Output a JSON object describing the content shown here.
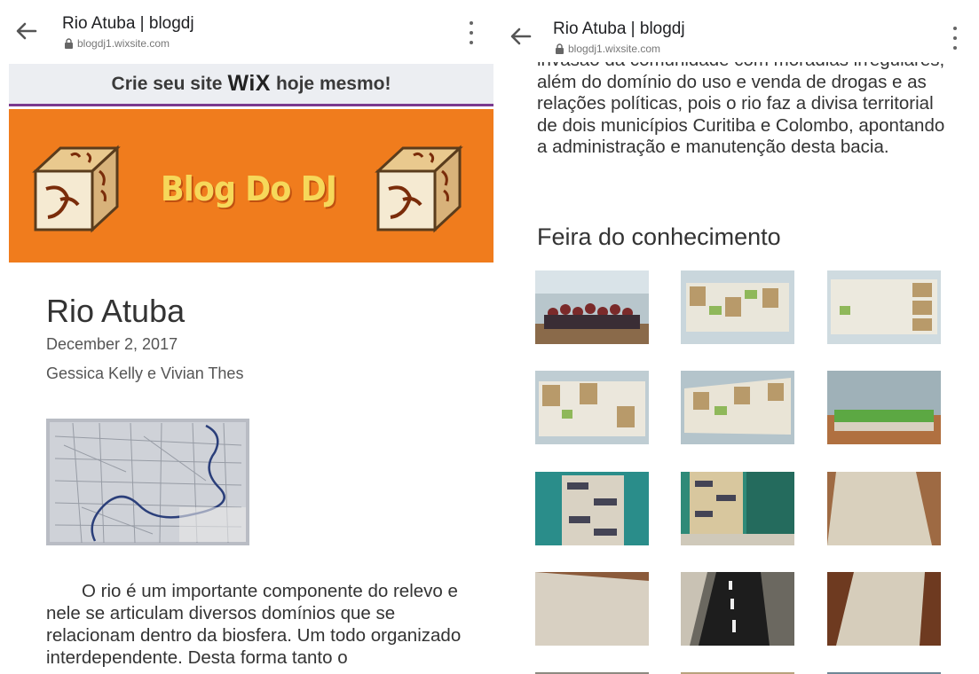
{
  "left": {
    "browser": {
      "title": "Rio Atuba | blogdj",
      "url": "blogdj1.wixsite.com"
    },
    "wix_banner": {
      "before": "Crie seu site",
      "brand": "WiX",
      "after": "hoje mesmo!"
    },
    "header": {
      "blog_name": "Blog Do DJ"
    },
    "post": {
      "title": "Rio Atuba",
      "date": "December 2, 2017",
      "authors": "Gessica Kelly e Vivian Thes",
      "body": "O rio é um importante componente do relevo e nele se articulam diversos domínios que se relacionam dentro da biosfera. Um todo organizado interdependente. Desta forma tanto o"
    }
  },
  "right": {
    "browser": {
      "title": "Rio Atuba | blogdj",
      "url": "blogdj1.wixsite.com"
    },
    "body_text": "invasão da comunidade com moradias irregulares, além do domínio do uso e venda de drogas e as relações políticas, pois o rio faz a divisa territorial de dois municípios Curitiba e Colombo, apontando a administração e manutenção desta bacia.",
    "section_heading": "Feira do conhecimento",
    "gallery_count": 15
  },
  "colors": {
    "header_orange": "#f07c1d",
    "banner_bg": "#eceef2",
    "banner_underline": "#7b3a8e",
    "blog_name_yellow": "#f6d85a"
  }
}
